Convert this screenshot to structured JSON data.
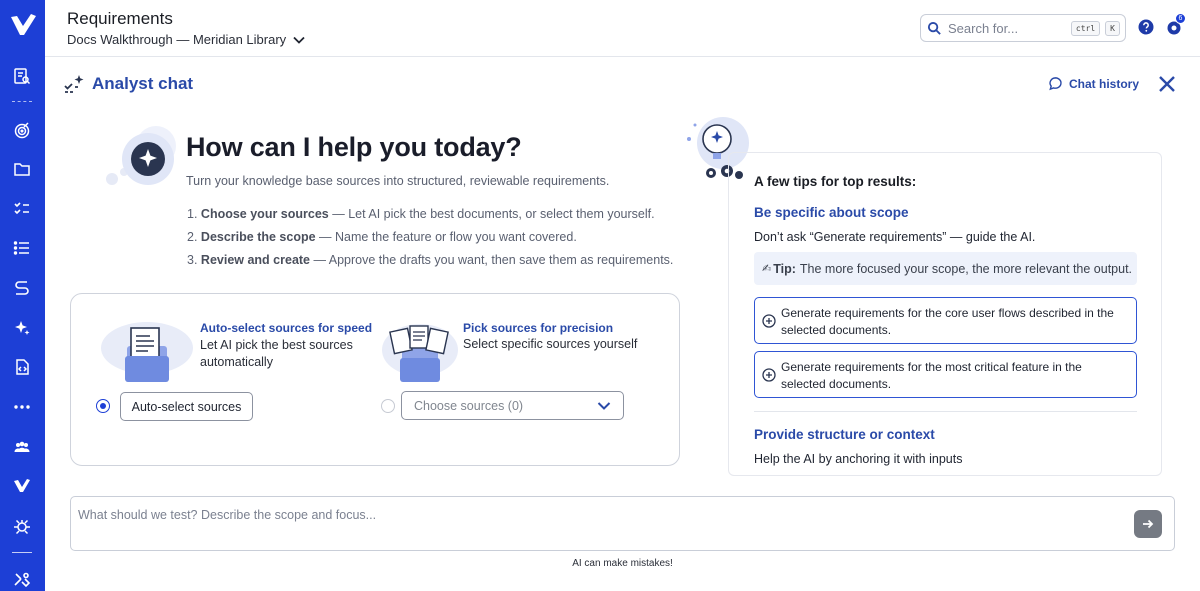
{
  "header": {
    "title": "Requirements",
    "project": "Docs Walkthrough — Meridian Library",
    "search_placeholder": "Search for...",
    "shortcut_ctrl": "ctrl",
    "shortcut_key": "K",
    "notification_count": "6"
  },
  "chat": {
    "title": "Analyst chat",
    "history_label": "Chat history"
  },
  "hero": {
    "title": "How can I help you today?",
    "subtitle": "Turn your knowledge base sources into structured, reviewable requirements.",
    "steps": [
      {
        "num": "1.",
        "bold": "Choose your sources",
        "text": " — Let AI pick the best documents, or select them yourself."
      },
      {
        "num": "2.",
        "bold": "Describe the scope",
        "text": " — Name the feature or flow you want covered."
      },
      {
        "num": "3.",
        "bold": "Review and create",
        "text": " — Approve the drafts you want, then save them as requirements."
      }
    ]
  },
  "sources": {
    "auto_title": "Auto-select sources for speed",
    "auto_desc": "Let AI pick the best sources automatically",
    "auto_button": "Auto-select sources",
    "pick_title": "Pick sources for precision",
    "pick_desc": "Select specific sources yourself",
    "pick_select": "Choose sources (0)"
  },
  "tips": {
    "heading": "A few tips for top results:",
    "tip1_title": "Be specific about scope",
    "tip1_desc": "Don’t ask “Generate requirements” — guide the AI.",
    "tipbox_label": "Tip:",
    "tipbox_text": "The more focused your scope, the more relevant the output.",
    "prompt1": "Generate requirements for the core user flows described in the selected documents.",
    "prompt2": "Generate requirements for the most critical feature in the selected documents.",
    "tip2_title": "Provide structure or context",
    "tip2_desc": "Help the AI by anchoring it with inputs"
  },
  "composer": {
    "placeholder": "What should we test? Describe the scope and focus...",
    "disclaimer": "AI can make mistakes!"
  },
  "colors": {
    "brand": "#1d3fd6",
    "accent_text": "#2a4aa8"
  }
}
